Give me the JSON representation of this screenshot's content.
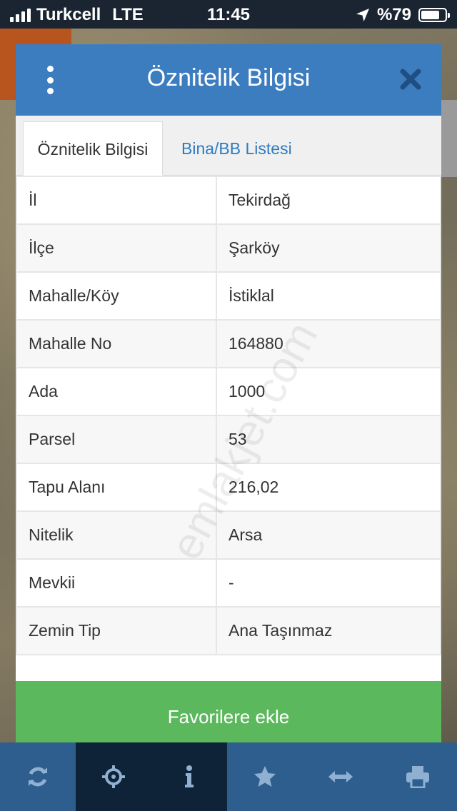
{
  "status_bar": {
    "carrier": "Turkcell",
    "network": "LTE",
    "time": "11:45",
    "battery": "%79",
    "battery_level": 0.79
  },
  "modal": {
    "title": "Öznitelik Bilgisi",
    "tabs": [
      {
        "label": "Öznitelik Bilgisi",
        "active": true
      },
      {
        "label": "Bina/BB Listesi",
        "active": false
      }
    ],
    "rows": [
      {
        "key": "İl",
        "value": "Tekirdağ"
      },
      {
        "key": "İlçe",
        "value": "Şarköy"
      },
      {
        "key": "Mahalle/Köy",
        "value": "İstiklal"
      },
      {
        "key": "Mahalle No",
        "value": "164880"
      },
      {
        "key": "Ada",
        "value": "1000"
      },
      {
        "key": "Parsel",
        "value": "53"
      },
      {
        "key": "Tapu Alanı",
        "value": "216,02"
      },
      {
        "key": "Nitelik",
        "value": "Arsa"
      },
      {
        "key": "Mevkii",
        "value": "-"
      },
      {
        "key": "Zemin Tip",
        "value": "Ana Taşınmaz"
      }
    ],
    "favorite_button": "Favorilere ekle"
  },
  "watermark": "emlakjet.com",
  "toolbar": {
    "icons": [
      "refresh-icon",
      "locate-icon",
      "info-icon",
      "star-icon",
      "measure-icon",
      "print-icon"
    ]
  },
  "colors": {
    "header": "#3c7dc0",
    "button": "#5cb85c",
    "toolbar": "#2d5e8e",
    "toolbar_active": "#0e2238"
  }
}
